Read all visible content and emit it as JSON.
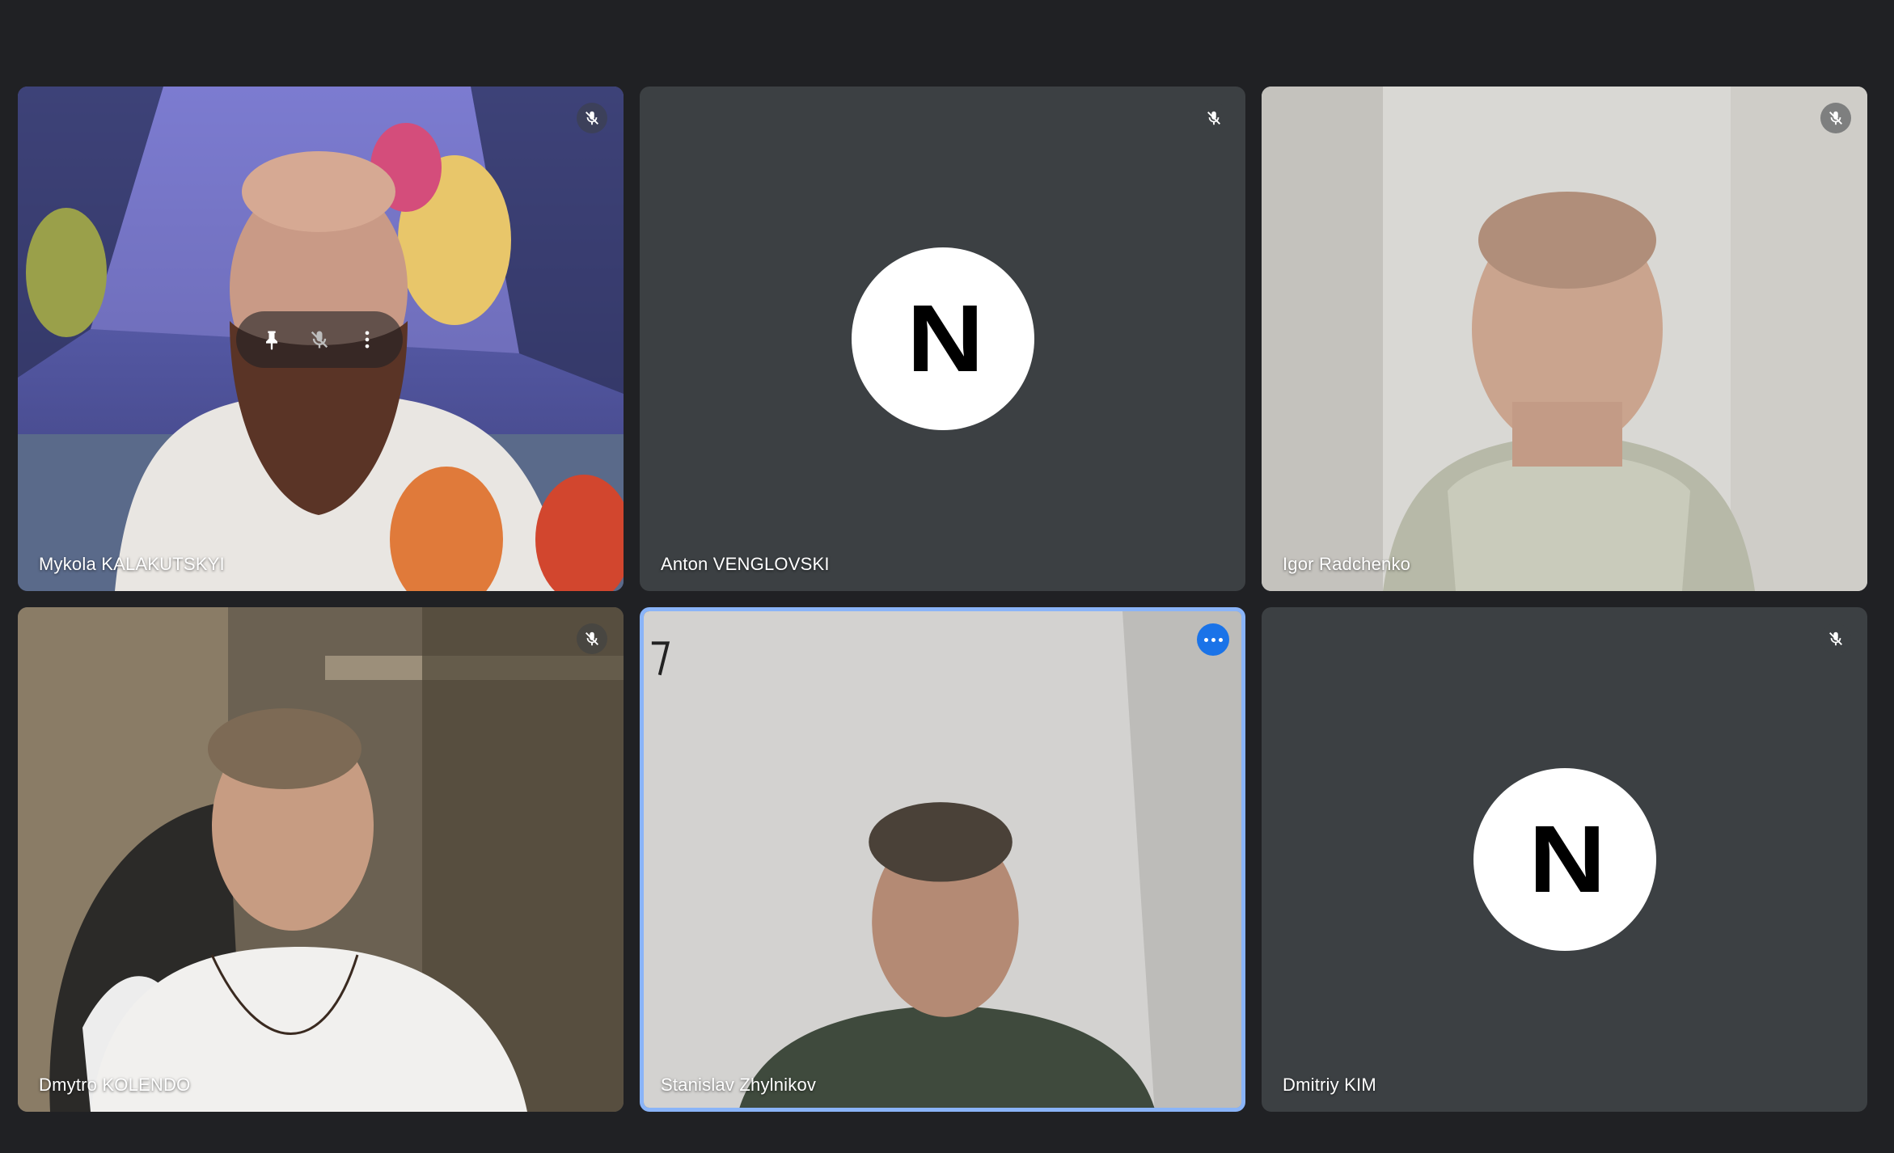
{
  "participants": [
    {
      "name": "Mykola KALAKUTSKYI",
      "muted": true,
      "avatar": null
    },
    {
      "name": "Anton VENGLOVSKI",
      "muted": true,
      "avatar": "N"
    },
    {
      "name": "Igor Radchenko",
      "muted": true,
      "avatar": null
    },
    {
      "name": "Dmytro KOLENDO",
      "muted": true,
      "avatar": null
    },
    {
      "name": "Stanislav Zhylnikov",
      "muted": false,
      "avatar": null,
      "speaking": true
    },
    {
      "name": "Dmitriy KIM",
      "muted": true,
      "avatar": "N"
    }
  ],
  "avatar_letter": "N",
  "avatar_mark": "©",
  "colors": {
    "background": "#202124",
    "tile": "#3c4043",
    "active_border": "#8ab4f8",
    "speaking_badge": "#1a73e8"
  },
  "icons": {
    "mute": "mic-off-icon",
    "pin": "pin-icon",
    "more": "more-vert-icon",
    "speaking": "more-horiz-icon"
  }
}
